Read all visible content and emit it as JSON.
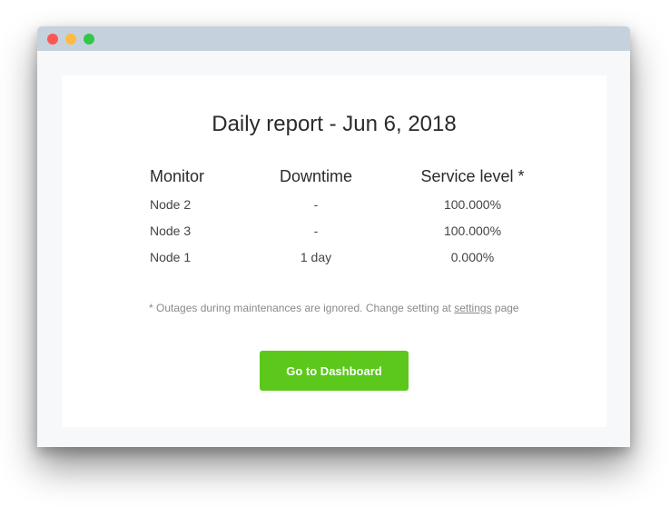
{
  "window": {
    "traffic_lights": [
      "close",
      "minimize",
      "maximize"
    ]
  },
  "report": {
    "title": "Daily report - Jun 6, 2018",
    "columns": [
      "Monitor",
      "Downtime",
      "Service level *"
    ],
    "rows": [
      {
        "monitor": "Node 2",
        "downtime": "-",
        "service_level": "100.000%"
      },
      {
        "monitor": "Node 3",
        "downtime": "-",
        "service_level": "100.000%"
      },
      {
        "monitor": "Node 1",
        "downtime": "1 day",
        "service_level": "0.000%"
      }
    ],
    "note_prefix": "* Outages during maintenances are ignored. Change setting at ",
    "note_link": "settings",
    "note_suffix": " page",
    "button_label": "Go to Dashboard"
  },
  "colors": {
    "titlebar": "#c5d2dd",
    "close": "#fc5753",
    "minimize": "#fdbc40",
    "maximize": "#33c748",
    "button": "#5bc81b"
  }
}
